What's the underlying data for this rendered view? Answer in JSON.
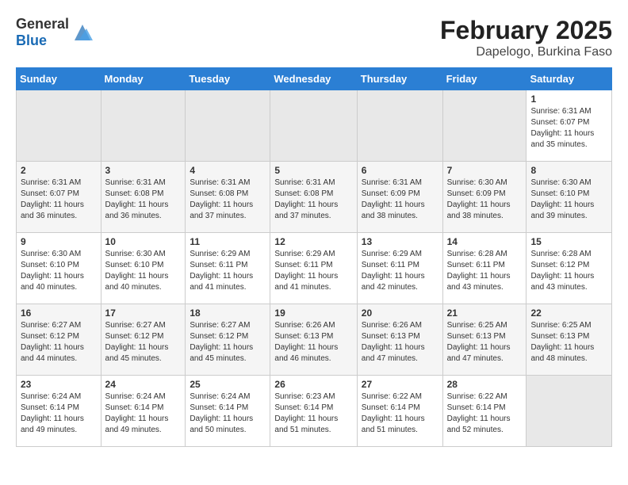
{
  "header": {
    "logo_general": "General",
    "logo_blue": "Blue",
    "title": "February 2025",
    "subtitle": "Dapelogo, Burkina Faso"
  },
  "days_of_week": [
    "Sunday",
    "Monday",
    "Tuesday",
    "Wednesday",
    "Thursday",
    "Friday",
    "Saturday"
  ],
  "weeks": [
    [
      {
        "day": "",
        "empty": true
      },
      {
        "day": "",
        "empty": true
      },
      {
        "day": "",
        "empty": true
      },
      {
        "day": "",
        "empty": true
      },
      {
        "day": "",
        "empty": true
      },
      {
        "day": "",
        "empty": true
      },
      {
        "day": "1",
        "sunrise": "6:31 AM",
        "sunset": "6:07 PM",
        "daylight": "11 hours and 35 minutes."
      }
    ],
    [
      {
        "day": "2",
        "sunrise": "6:31 AM",
        "sunset": "6:07 PM",
        "daylight": "11 hours and 36 minutes."
      },
      {
        "day": "3",
        "sunrise": "6:31 AM",
        "sunset": "6:08 PM",
        "daylight": "11 hours and 36 minutes."
      },
      {
        "day": "4",
        "sunrise": "6:31 AM",
        "sunset": "6:08 PM",
        "daylight": "11 hours and 37 minutes."
      },
      {
        "day": "5",
        "sunrise": "6:31 AM",
        "sunset": "6:08 PM",
        "daylight": "11 hours and 37 minutes."
      },
      {
        "day": "6",
        "sunrise": "6:31 AM",
        "sunset": "6:09 PM",
        "daylight": "11 hours and 38 minutes."
      },
      {
        "day": "7",
        "sunrise": "6:30 AM",
        "sunset": "6:09 PM",
        "daylight": "11 hours and 38 minutes."
      },
      {
        "day": "8",
        "sunrise": "6:30 AM",
        "sunset": "6:10 PM",
        "daylight": "11 hours and 39 minutes."
      }
    ],
    [
      {
        "day": "9",
        "sunrise": "6:30 AM",
        "sunset": "6:10 PM",
        "daylight": "11 hours and 40 minutes."
      },
      {
        "day": "10",
        "sunrise": "6:30 AM",
        "sunset": "6:10 PM",
        "daylight": "11 hours and 40 minutes."
      },
      {
        "day": "11",
        "sunrise": "6:29 AM",
        "sunset": "6:11 PM",
        "daylight": "11 hours and 41 minutes."
      },
      {
        "day": "12",
        "sunrise": "6:29 AM",
        "sunset": "6:11 PM",
        "daylight": "11 hours and 41 minutes."
      },
      {
        "day": "13",
        "sunrise": "6:29 AM",
        "sunset": "6:11 PM",
        "daylight": "11 hours and 42 minutes."
      },
      {
        "day": "14",
        "sunrise": "6:28 AM",
        "sunset": "6:11 PM",
        "daylight": "11 hours and 43 minutes."
      },
      {
        "day": "15",
        "sunrise": "6:28 AM",
        "sunset": "6:12 PM",
        "daylight": "11 hours and 43 minutes."
      }
    ],
    [
      {
        "day": "16",
        "sunrise": "6:27 AM",
        "sunset": "6:12 PM",
        "daylight": "11 hours and 44 minutes."
      },
      {
        "day": "17",
        "sunrise": "6:27 AM",
        "sunset": "6:12 PM",
        "daylight": "11 hours and 45 minutes."
      },
      {
        "day": "18",
        "sunrise": "6:27 AM",
        "sunset": "6:12 PM",
        "daylight": "11 hours and 45 minutes."
      },
      {
        "day": "19",
        "sunrise": "6:26 AM",
        "sunset": "6:13 PM",
        "daylight": "11 hours and 46 minutes."
      },
      {
        "day": "20",
        "sunrise": "6:26 AM",
        "sunset": "6:13 PM",
        "daylight": "11 hours and 47 minutes."
      },
      {
        "day": "21",
        "sunrise": "6:25 AM",
        "sunset": "6:13 PM",
        "daylight": "11 hours and 47 minutes."
      },
      {
        "day": "22",
        "sunrise": "6:25 AM",
        "sunset": "6:13 PM",
        "daylight": "11 hours and 48 minutes."
      }
    ],
    [
      {
        "day": "23",
        "sunrise": "6:24 AM",
        "sunset": "6:14 PM",
        "daylight": "11 hours and 49 minutes."
      },
      {
        "day": "24",
        "sunrise": "6:24 AM",
        "sunset": "6:14 PM",
        "daylight": "11 hours and 49 minutes."
      },
      {
        "day": "25",
        "sunrise": "6:24 AM",
        "sunset": "6:14 PM",
        "daylight": "11 hours and 50 minutes."
      },
      {
        "day": "26",
        "sunrise": "6:23 AM",
        "sunset": "6:14 PM",
        "daylight": "11 hours and 51 minutes."
      },
      {
        "day": "27",
        "sunrise": "6:22 AM",
        "sunset": "6:14 PM",
        "daylight": "11 hours and 51 minutes."
      },
      {
        "day": "28",
        "sunrise": "6:22 AM",
        "sunset": "6:14 PM",
        "daylight": "11 hours and 52 minutes."
      },
      {
        "day": "",
        "empty": true
      }
    ]
  ]
}
